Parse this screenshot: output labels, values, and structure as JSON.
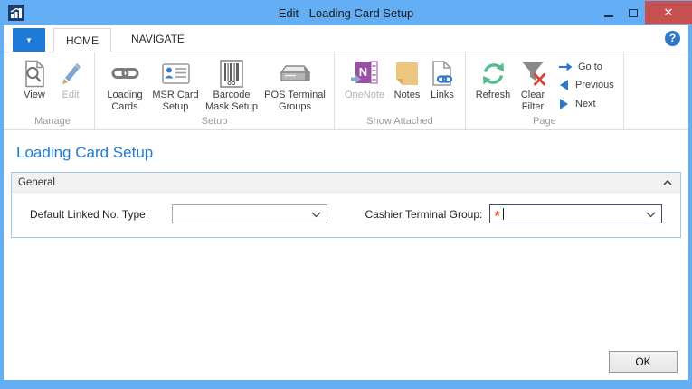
{
  "window": {
    "title": "Edit - Loading Card Setup",
    "close_glyph": "✕"
  },
  "menu": {
    "app_menu_glyph": "▼"
  },
  "help_glyph": "?",
  "tabs": [
    {
      "label": "HOME",
      "active": true
    },
    {
      "label": "NAVIGATE",
      "active": false
    }
  ],
  "ribbon": {
    "groups": [
      {
        "label": "Manage",
        "buttons": [
          {
            "label": "View",
            "disabled": false
          },
          {
            "label": "Edit",
            "disabled": true
          }
        ]
      },
      {
        "label": "Setup",
        "buttons": [
          {
            "label": "Loading Cards",
            "disabled": false
          },
          {
            "label": "MSR Card Setup",
            "disabled": false
          },
          {
            "label": "Barcode Mask Setup",
            "disabled": false
          },
          {
            "label": "POS Terminal Groups",
            "disabled": false
          }
        ]
      },
      {
        "label": "Show Attached",
        "buttons": [
          {
            "label": "OneNote",
            "disabled": true
          },
          {
            "label": "Notes",
            "disabled": false
          },
          {
            "label": "Links",
            "disabled": false
          }
        ]
      },
      {
        "label": "Page",
        "buttons": [
          {
            "label": "Refresh",
            "disabled": false
          },
          {
            "label": "Clear Filter",
            "disabled": false
          }
        ],
        "nav_buttons": [
          {
            "label": "Go to"
          },
          {
            "label": "Previous"
          },
          {
            "label": "Next"
          }
        ]
      }
    ]
  },
  "page": {
    "title": "Loading Card Setup",
    "sections": [
      {
        "label": "General",
        "collapsed": false,
        "fields": [
          {
            "label": "Default Linked No. Type:",
            "value": "",
            "required": false,
            "focused": false
          },
          {
            "label": "Cashier Terminal Group:",
            "value": "",
            "required": true,
            "required_glyph": "*",
            "focused": true
          }
        ]
      }
    ]
  },
  "footer": {
    "ok_label": "OK"
  },
  "colors": {
    "titlebar_blue": "#63aef5",
    "app_menu_blue": "#1e7bd8",
    "close_red": "#c75050",
    "page_title_blue": "#1e7ad6",
    "accent_icon_blue": "#2e77c9",
    "refresh_green": "#57bb8d",
    "clear_filter_red": "#d14836",
    "notes_yellow": "#ecc57f",
    "onenote_purple": "#9a4ea6",
    "required_red": "#e0563f",
    "fasttab_border": "#a9c6e4"
  }
}
